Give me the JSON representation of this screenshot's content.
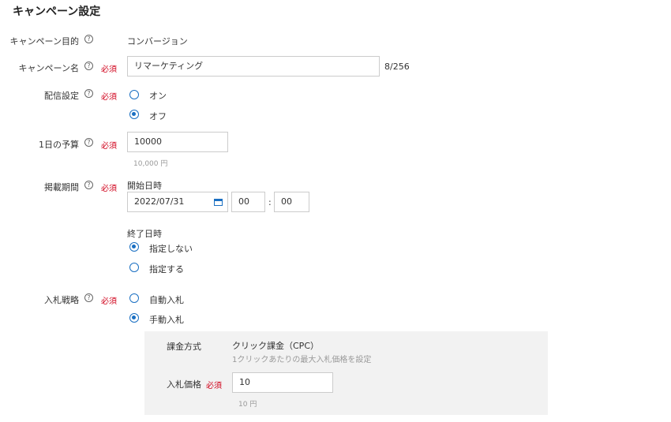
{
  "page": {
    "title": "キャンペーン設定"
  },
  "help_glyph": "?",
  "required_label": "必須",
  "fields": {
    "objective": {
      "label": "キャンペーン目的",
      "value": "コンバージョン"
    },
    "name": {
      "label": "キャンペーン名",
      "value": "リマーケティング",
      "counter": "8/256"
    },
    "delivery": {
      "label": "配信設定",
      "options": [
        "オン",
        "オフ"
      ],
      "selected": "オフ"
    },
    "budget": {
      "label": "1日の予算",
      "value": "10000",
      "hint": "10,000 円"
    },
    "period": {
      "label": "掲載期間",
      "start_label": "開始日時",
      "start_date": "2022/07/31",
      "start_hour": "00",
      "time_sep": ":",
      "start_minute": "00",
      "end_label": "終了日時",
      "end_options": [
        "指定しない",
        "指定する"
      ],
      "end_selected": "指定しない"
    },
    "bidding": {
      "label": "入札戦略",
      "options": [
        "自動入札",
        "手動入札"
      ],
      "selected": "手動入札",
      "detail": {
        "billing_label": "課金方式",
        "billing_value": "クリック課金（CPC）",
        "billing_desc": "1クリックあたりの最大入札価格を設定",
        "bid_label": "入札価格",
        "bid_value": "10",
        "bid_hint": "10 円"
      }
    }
  },
  "colors": {
    "accent": "#1a6fc2",
    "required": "#d0021b",
    "panel": "#f2f2f2"
  },
  "icons": [
    "help-icon",
    "calendar-icon"
  ]
}
